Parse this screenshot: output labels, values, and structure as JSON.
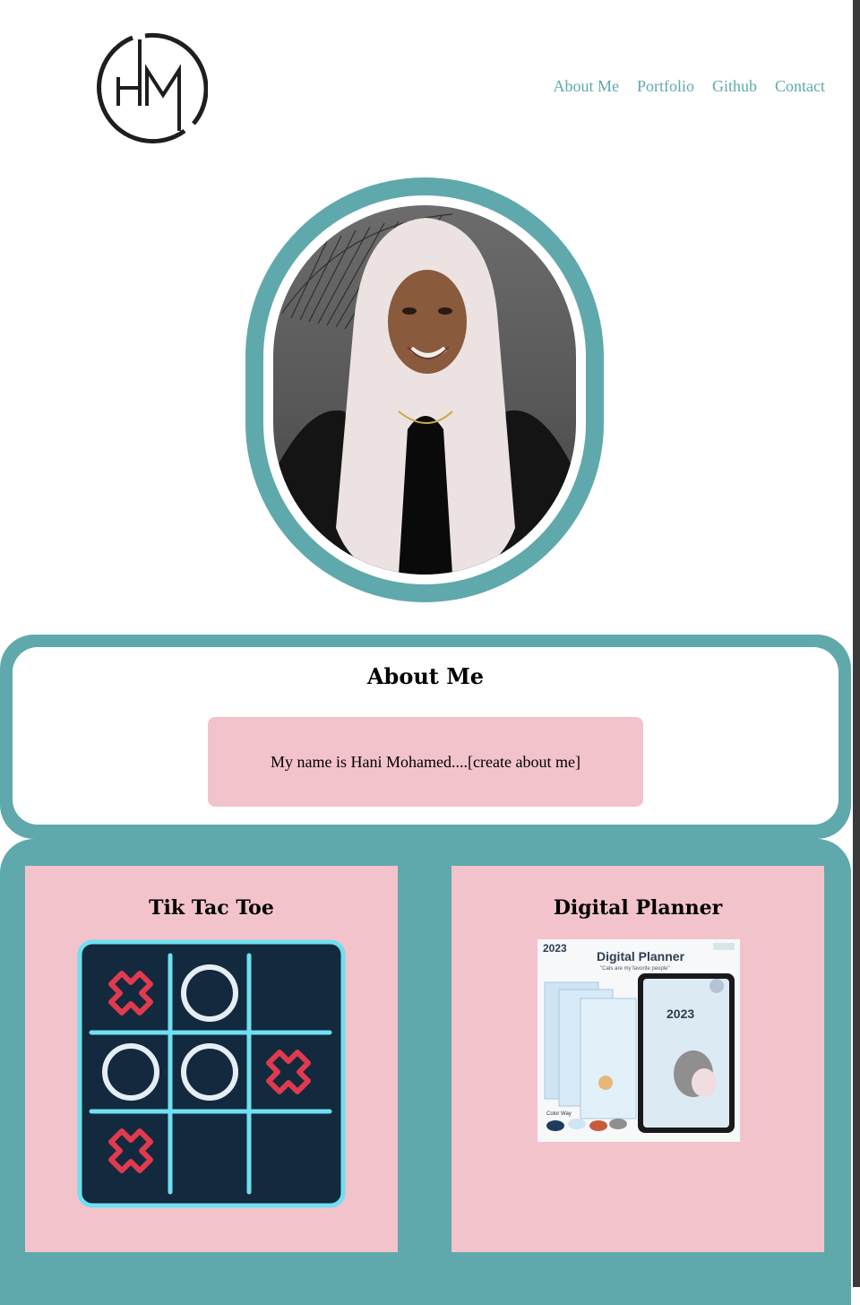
{
  "brand": {
    "logo_letters": "HM"
  },
  "nav": {
    "items": [
      "About Me",
      "Portfolio",
      "Github",
      "Contact"
    ]
  },
  "about": {
    "title": "About Me",
    "text": "My name is Hani Mohamed....[create about me]"
  },
  "projects": [
    {
      "title": "Tik Tac Toe"
    },
    {
      "title": "Digital Planner",
      "image_year": "2023",
      "image_heading": "Digital Planner",
      "image_tagline": "\"Cats are my favorite people\"",
      "tablet_year": "2023",
      "color_way_label": "Color Way"
    }
  ],
  "colors": {
    "accent": "#5fa9ac",
    "pink": "#f3c3cc",
    "navy": "#13293d",
    "cyan": "#6ee0f0",
    "red": "#e03a4e"
  }
}
